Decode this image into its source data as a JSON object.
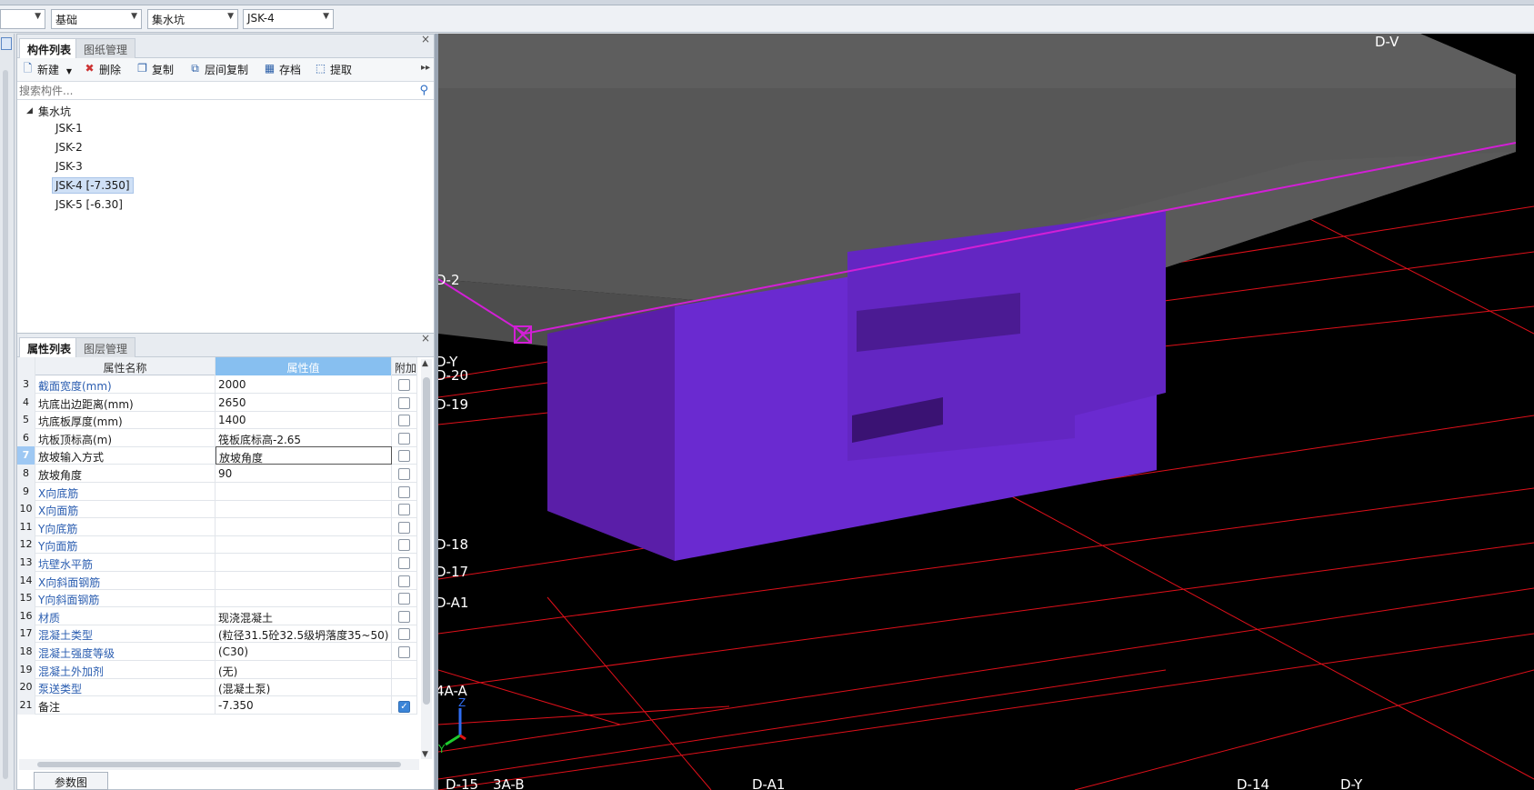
{
  "toolbar": {
    "combos": [
      {
        "value": "",
        "name": "floor-combo"
      },
      {
        "value": "基础",
        "name": "category-combo"
      },
      {
        "value": "集水坑",
        "name": "type-combo"
      },
      {
        "value": "JSK-4",
        "name": "component-combo"
      }
    ]
  },
  "component_panel": {
    "tabs": [
      "构件列表",
      "图纸管理"
    ],
    "actions": {
      "new": "新建",
      "delete": "删除",
      "copy": "复制",
      "floor_copy": "层间复制",
      "archive": "存档",
      "extract": "提取"
    },
    "search_placeholder": "搜索构件...",
    "tree": {
      "root": "集水坑",
      "items": [
        "JSK-1",
        "JSK-2",
        "JSK-3",
        "JSK-4 [-7.350]",
        "JSK-5 [-6.30]"
      ],
      "selected_index": 3
    }
  },
  "property_panel": {
    "tabs": [
      "属性列表",
      "图层管理"
    ],
    "columns": {
      "name": "属性名称",
      "value": "属性值",
      "extra": "附加"
    },
    "rows": [
      {
        "num": "3",
        "name": "截面宽度(mm)",
        "value": "2000",
        "link": true,
        "check": "unchecked"
      },
      {
        "num": "4",
        "name": "坑底出边距离(mm)",
        "value": "2650",
        "link": false,
        "check": "unchecked"
      },
      {
        "num": "5",
        "name": "坑底板厚度(mm)",
        "value": "1400",
        "link": false,
        "check": "unchecked"
      },
      {
        "num": "6",
        "name": "坑板顶标高(m)",
        "value": "筏板底标高-2.65",
        "link": false,
        "check": "unchecked"
      },
      {
        "num": "7",
        "name": "放坡输入方式",
        "value": "放坡角度",
        "link": false,
        "check": "unchecked",
        "active": true
      },
      {
        "num": "8",
        "name": "放坡角度",
        "value": "90",
        "link": false,
        "check": "unchecked"
      },
      {
        "num": "9",
        "name": "X向底筋",
        "value": "",
        "link": true,
        "check": "unchecked"
      },
      {
        "num": "10",
        "name": "X向面筋",
        "value": "",
        "link": true,
        "check": "unchecked"
      },
      {
        "num": "11",
        "name": "Y向底筋",
        "value": "",
        "link": true,
        "check": "unchecked"
      },
      {
        "num": "12",
        "name": "Y向面筋",
        "value": "",
        "link": true,
        "check": "unchecked"
      },
      {
        "num": "13",
        "name": "坑壁水平筋",
        "value": "",
        "link": true,
        "check": "unchecked"
      },
      {
        "num": "14",
        "name": "X向斜面钢筋",
        "value": "",
        "link": true,
        "check": "unchecked"
      },
      {
        "num": "15",
        "name": "Y向斜面钢筋",
        "value": "",
        "link": true,
        "check": "unchecked"
      },
      {
        "num": "16",
        "name": "材质",
        "value": "现浇混凝土",
        "link": true,
        "check": "unchecked"
      },
      {
        "num": "17",
        "name": "混凝土类型",
        "value": "(粒径31.5砼32.5级坍落度35~50)",
        "link": true,
        "check": "unchecked"
      },
      {
        "num": "18",
        "name": "混凝土强度等级",
        "value": "(C30)",
        "link": true,
        "check": "unchecked"
      },
      {
        "num": "19",
        "name": "混凝土外加剂",
        "value": "(无)",
        "link": true,
        "check": "none"
      },
      {
        "num": "20",
        "name": "泵送类型",
        "value": "(混凝土泵)",
        "link": true,
        "check": "none"
      },
      {
        "num": "21",
        "name": "备注",
        "value": "-7.350",
        "link": false,
        "check": "checked"
      }
    ],
    "param_button": "参数图"
  },
  "viewport": {
    "axis_labels": [
      {
        "text": "D-V"
      },
      {
        "text": "D-2"
      },
      {
        "text": "D-Y"
      },
      {
        "text": "D-20"
      },
      {
        "text": "D-19"
      },
      {
        "text": "D-18"
      },
      {
        "text": "D-17"
      },
      {
        "text": "D-A1"
      },
      {
        "text": "4A-A"
      },
      {
        "text": "D-15"
      },
      {
        "text": "3A-B"
      },
      {
        "text": "D-A1"
      },
      {
        "text": "D-14"
      },
      {
        "text": "D-Y"
      }
    ],
    "colors": {
      "slab": "#555555",
      "pit": "#6a2fd4",
      "grid": "#e0101a",
      "edge": "#d21fd6"
    }
  }
}
